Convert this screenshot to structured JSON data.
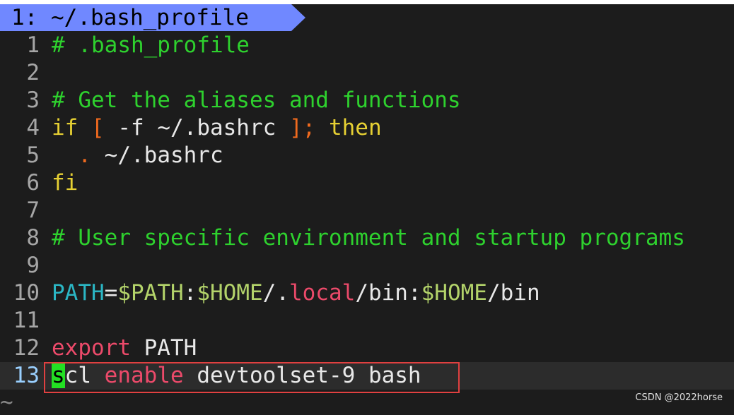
{
  "tab": {
    "label": "1: ~/.bash_profile"
  },
  "lines": [
    {
      "num": "1",
      "segments": [
        {
          "text": "# .bash_profile",
          "cls": "comment"
        }
      ]
    },
    {
      "num": "2",
      "segments": []
    },
    {
      "num": "3",
      "segments": [
        {
          "text": "# Get the aliases and functions",
          "cls": "comment"
        }
      ]
    },
    {
      "num": "4",
      "segments": [
        {
          "text": "if",
          "cls": "keyword"
        },
        {
          "text": " ",
          "cls": "plain"
        },
        {
          "text": "[",
          "cls": "bracket"
        },
        {
          "text": " -f ~/.bashrc ",
          "cls": "plain"
        },
        {
          "text": "];",
          "cls": "bracket"
        },
        {
          "text": " ",
          "cls": "plain"
        },
        {
          "text": "then",
          "cls": "keyword"
        }
      ]
    },
    {
      "num": "5",
      "segments": [
        {
          "text": "  ",
          "cls": "plain"
        },
        {
          "text": ".",
          "cls": "bracket"
        },
        {
          "text": " ~/.bashrc",
          "cls": "plain"
        }
      ]
    },
    {
      "num": "6",
      "segments": [
        {
          "text": "fi",
          "cls": "keyword"
        }
      ]
    },
    {
      "num": "7",
      "segments": []
    },
    {
      "num": "8",
      "segments": [
        {
          "text": "# User specific environment and startup programs",
          "cls": "comment"
        }
      ]
    },
    {
      "num": "9",
      "segments": []
    },
    {
      "num": "10",
      "segments": [
        {
          "text": "PATH",
          "cls": "var"
        },
        {
          "text": "=",
          "cls": "plain"
        },
        {
          "text": "$PATH",
          "cls": "dollar"
        },
        {
          "text": ":",
          "cls": "plain"
        },
        {
          "text": "$HOME",
          "cls": "dollar"
        },
        {
          "text": "/.",
          "cls": "plain"
        },
        {
          "text": "local",
          "cls": "local"
        },
        {
          "text": "/bin:",
          "cls": "plain"
        },
        {
          "text": "$HOME",
          "cls": "dollar"
        },
        {
          "text": "/bin",
          "cls": "plain"
        }
      ]
    },
    {
      "num": "11",
      "segments": []
    },
    {
      "num": "12",
      "segments": [
        {
          "text": "export",
          "cls": "cmd"
        },
        {
          "text": " PATH",
          "cls": "plain"
        }
      ]
    },
    {
      "num": "13",
      "cursorline": true,
      "segments": [
        {
          "text": "s",
          "cls": "cursor"
        },
        {
          "text": "cl ",
          "cls": "plain"
        },
        {
          "text": "enable",
          "cls": "cmd"
        },
        {
          "text": " devtoolset-9 bash",
          "cls": "plain"
        }
      ]
    }
  ],
  "eob_marker": "~",
  "watermark": "CSDN @2022horse",
  "colors": {
    "tab_bg": "#7088ff",
    "comment": "#2ed12e",
    "keyword": "#e6d033",
    "cursor": "#23e023",
    "highlight_box": "#e04040"
  }
}
